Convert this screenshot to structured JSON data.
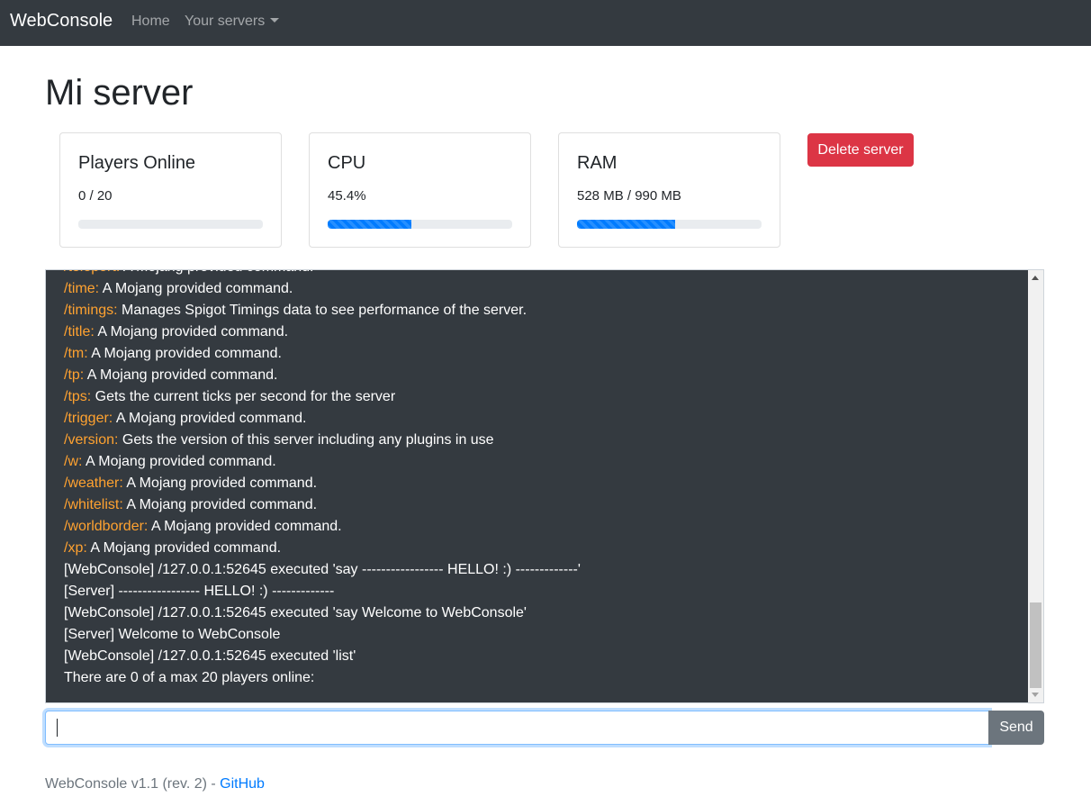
{
  "navbar": {
    "brand": "WebConsole",
    "home": "Home",
    "servers": "Your servers"
  },
  "page": {
    "title": "Mi server"
  },
  "stats": {
    "players": {
      "title": "Players Online",
      "value": "0 / 20",
      "progress": 0
    },
    "cpu": {
      "title": "CPU",
      "value": "45.4%",
      "progress": 45.4
    },
    "ram": {
      "title": "RAM",
      "value": "528 MB / 990 MB",
      "progress": 53.3
    }
  },
  "actions": {
    "delete_label": "Delete server"
  },
  "console": {
    "lines": [
      {
        "cmd": "/teleport:",
        "text": " A Mojang provided command."
      },
      {
        "cmd": "/time:",
        "text": " A Mojang provided command."
      },
      {
        "cmd": "/timings:",
        "text": " Manages Spigot Timings data to see performance of the server."
      },
      {
        "cmd": "/title:",
        "text": " A Mojang provided command."
      },
      {
        "cmd": "/tm:",
        "text": " A Mojang provided command."
      },
      {
        "cmd": "/tp:",
        "text": " A Mojang provided command."
      },
      {
        "cmd": "/tps:",
        "text": " Gets the current ticks per second for the server"
      },
      {
        "cmd": "/trigger:",
        "text": " A Mojang provided command."
      },
      {
        "cmd": "/version:",
        "text": " Gets the version of this server including any plugins in use"
      },
      {
        "cmd": "/w:",
        "text": " A Mojang provided command."
      },
      {
        "cmd": "/weather:",
        "text": " A Mojang provided command."
      },
      {
        "cmd": "/whitelist:",
        "text": " A Mojang provided command."
      },
      {
        "cmd": "/worldborder:",
        "text": " A Mojang provided command."
      },
      {
        "cmd": "/xp:",
        "text": " A Mojang provided command."
      },
      {
        "cmd": "",
        "text": "[WebConsole] /127.0.0.1:52645 executed 'say ----------------- HELLO! :) -------------'"
      },
      {
        "cmd": "",
        "text": "[Server] ----------------- HELLO! :) -------------"
      },
      {
        "cmd": "",
        "text": "[WebConsole] /127.0.0.1:52645 executed 'say Welcome to WebConsole'"
      },
      {
        "cmd": "",
        "text": "[Server] Welcome to WebConsole"
      },
      {
        "cmd": "",
        "text": "[WebConsole] /127.0.0.1:52645 executed 'list'"
      },
      {
        "cmd": "",
        "text": "There are 0 of a max 20 players online:"
      }
    ]
  },
  "input": {
    "value": "",
    "send_label": "Send"
  },
  "footer": {
    "version": "WebConsole v1.1 (rev. 2) - ",
    "link": "GitHub"
  },
  "colors": {
    "navbar": "#343a40",
    "console_bg": "#343a40",
    "command": "#ffa230",
    "danger": "#dc3545",
    "primary": "#007bff",
    "secondary": "#6c757d"
  }
}
